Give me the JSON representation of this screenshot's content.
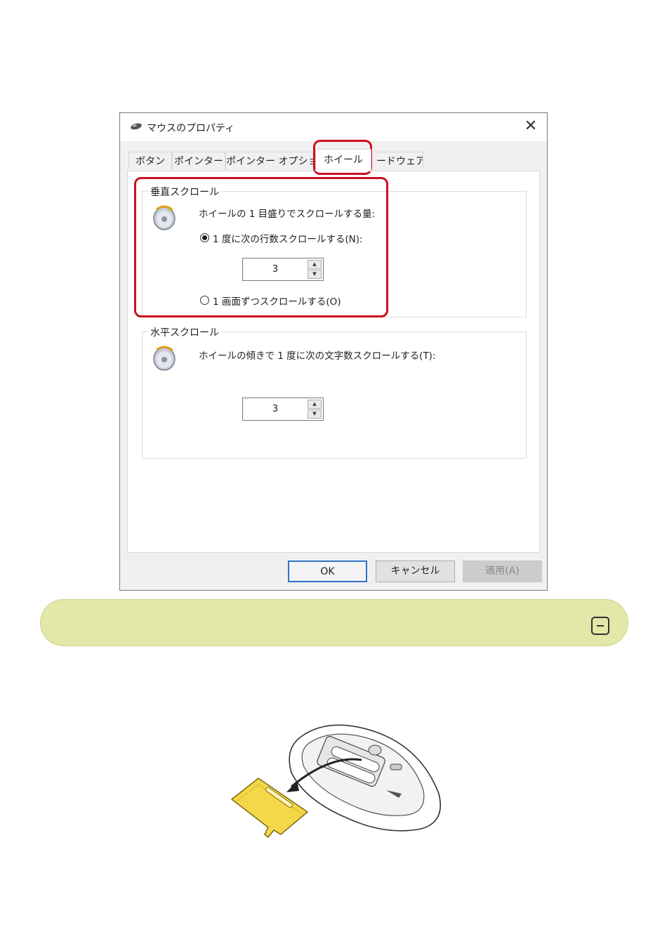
{
  "dialog": {
    "title": "マウスのプロパティ",
    "close_glyph": "✕",
    "tabs": [
      {
        "label": "ボタン"
      },
      {
        "label": "ポインター"
      },
      {
        "label": "ポインター オプショ"
      },
      {
        "label": "ホイール",
        "active": true
      },
      {
        "label": "ードウェア"
      }
    ],
    "vertical_scroll": {
      "legend": "垂直スクロール",
      "icon": "mouse-wheel-icon",
      "description": "ホイールの 1 目盛りでスクロールする量:",
      "option_lines": {
        "label": "1 度に次の行数スクロールする(N):",
        "checked": true
      },
      "lines_value": "3",
      "option_screen": {
        "label": "1 画面ずつスクロールする(O)",
        "checked": false
      }
    },
    "horizontal_scroll": {
      "legend": "水平スクロール",
      "icon": "mouse-wheel-icon",
      "description": "ホイールの傾きで 1 度に次の文字数スクロールする(T):",
      "chars_value": "3"
    },
    "buttons": {
      "ok": "OK",
      "cancel": "キャンセル",
      "apply": "適用(A)"
    }
  },
  "highlight_color": "#cc1020",
  "banner": {
    "background": "#e3e7a7",
    "icon": "collapse-minus-icon"
  },
  "illustration": {
    "description_icon": "mouse-battery-cover-removal-illustration",
    "cover_color": "#f5d84a"
  }
}
